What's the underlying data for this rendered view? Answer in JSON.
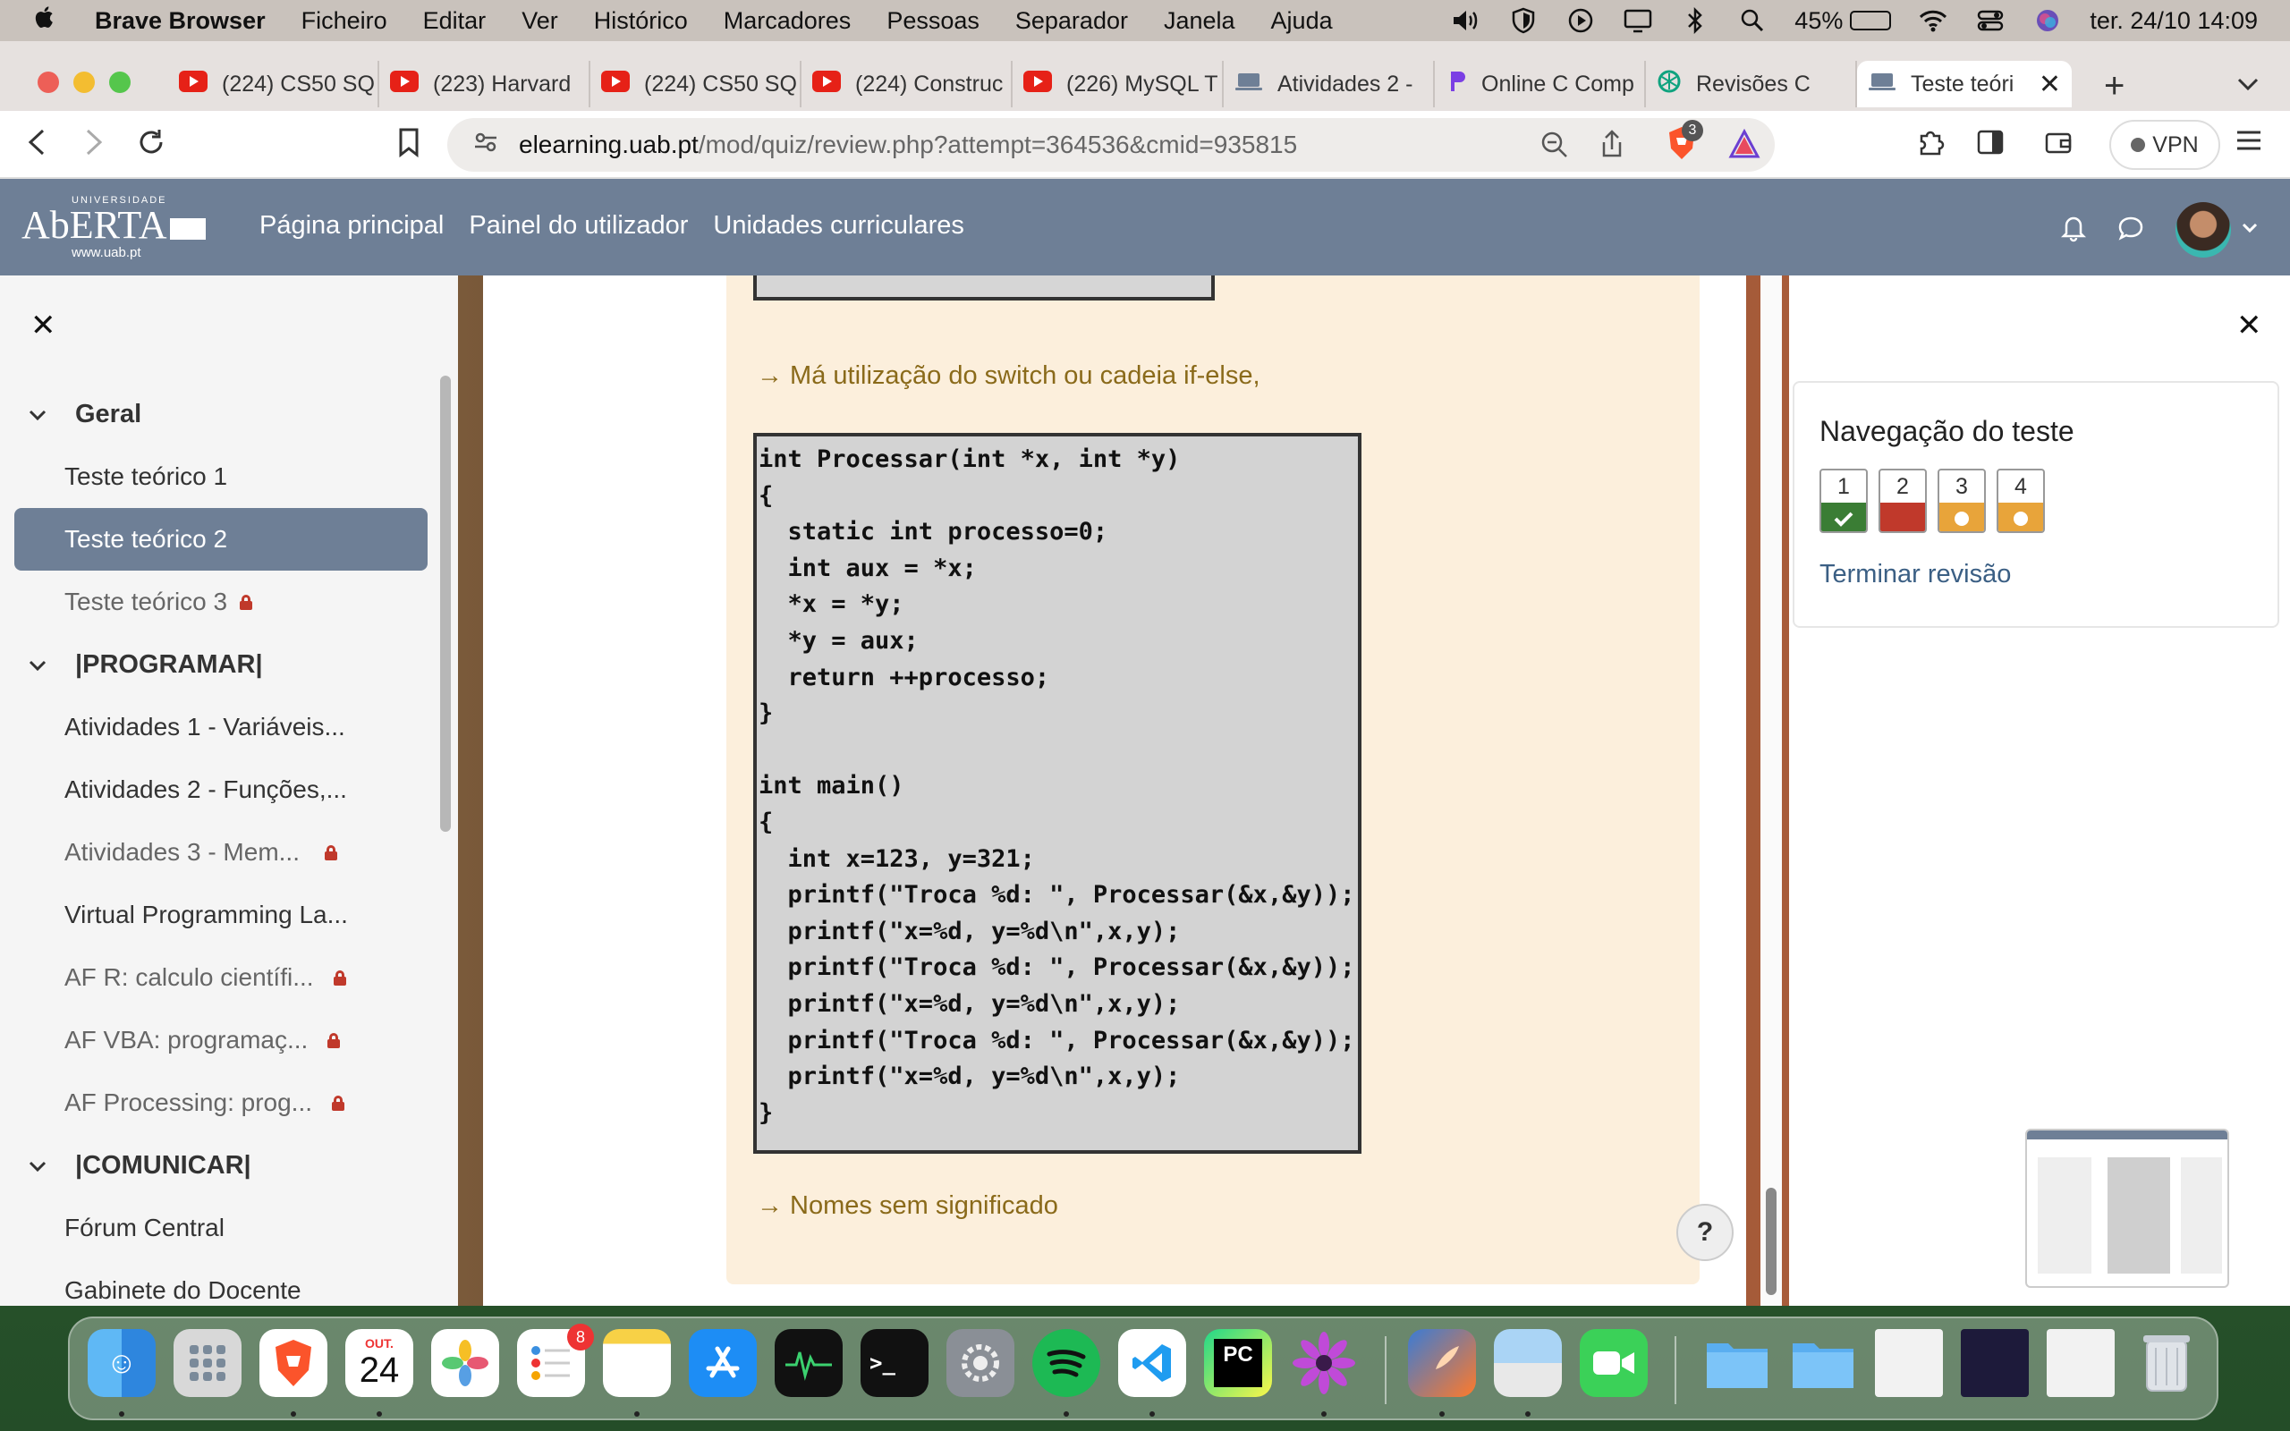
{
  "menubar": {
    "app": "Brave Browser",
    "items": [
      "Ficheiro",
      "Editar",
      "Ver",
      "Histórico",
      "Marcadores",
      "Pessoas",
      "Separador",
      "Janela",
      "Ajuda"
    ],
    "battery": "45%",
    "datetime": "ter. 24/10  14:09"
  },
  "tabs": [
    {
      "label": "(224) CS50 SQ",
      "icon": "youtube-icon"
    },
    {
      "label": "(223) Harvard",
      "icon": "youtube-icon"
    },
    {
      "label": "(224) CS50 SQ",
      "icon": "youtube-icon"
    },
    {
      "label": "(224) Construc",
      "icon": "youtube-icon"
    },
    {
      "label": "(226) MySQL T",
      "icon": "youtube-icon"
    },
    {
      "label": "Atividades 2 -",
      "icon": "laptop-icon"
    },
    {
      "label": "Online C Comp",
      "icon": "code-icon"
    },
    {
      "label": "Revisões C",
      "icon": "chatgpt-icon"
    },
    {
      "label": "Teste teóri",
      "icon": "laptop-icon",
      "active": true
    }
  ],
  "toolbar": {
    "url_host": "elearning.uab.pt",
    "url_path": "/mod/quiz/review.php?attempt=364536&cmid=935815",
    "brave_badge": "3",
    "vpn_label": "VPN"
  },
  "site": {
    "logo_top": "UNIVERSIDADE",
    "logo_name": "AbERTA",
    "logo_www": "www.uab.pt",
    "nav": [
      "Página principal",
      "Painel do utilizador",
      "Unidades curriculares"
    ]
  },
  "drawer": {
    "sections": [
      {
        "title": "Geral",
        "items": [
          {
            "label": "Teste teórico 1"
          },
          {
            "label": "Teste teórico 2",
            "active": true
          },
          {
            "label": "Teste teórico 3",
            "locked": true,
            "muted": true
          }
        ]
      },
      {
        "title": "|PROGRAMAR|",
        "items": [
          {
            "label": "Atividades 1 - Variáveis..."
          },
          {
            "label": "Atividades 2 - Funções,..."
          },
          {
            "label": "Atividades 3 - Mem...",
            "locked": true,
            "muted": true
          },
          {
            "label": "Virtual Programming La..."
          },
          {
            "label": "AF R: calculo científi...",
            "locked": true,
            "muted": true
          },
          {
            "label": "AF VBA: programaç...",
            "locked": true,
            "muted": true
          },
          {
            "label": "AF Processing: prog...",
            "locked": true,
            "muted": true
          }
        ]
      },
      {
        "title": "|COMUNICAR|",
        "items": [
          {
            "label": "Fórum Central"
          },
          {
            "label": "Gabinete do Docente"
          }
        ]
      }
    ]
  },
  "question": {
    "note1": "→ Má utilização do switch ou cadeia if-else,",
    "code": "int Processar(int *x, int *y)\n{\n  static int processo=0;\n  int aux = *x;\n  *x = *y;\n  *y = aux;\n  return ++processo;\n}\n\nint main()\n{\n  int x=123, y=321;\n  printf(\"Troca %d: \", Processar(&x,&y));\n  printf(\"x=%d, y=%d\\n\",x,y);\n  printf(\"Troca %d: \", Processar(&x,&y));\n  printf(\"x=%d, y=%d\\n\",x,y);\n  printf(\"Troca %d: \", Processar(&x,&y));\n  printf(\"x=%d, y=%d\\n\",x,y);\n}",
    "note2": "→ Nomes sem significado"
  },
  "quiznav": {
    "title": "Navegação do teste",
    "questions": [
      {
        "num": "1",
        "state": "correct",
        "color": "#3a7d34"
      },
      {
        "num": "2",
        "state": "incorrect",
        "color": "#c0392b"
      },
      {
        "num": "3",
        "state": "partial",
        "color": "#e8a43a"
      },
      {
        "num": "4",
        "state": "partial",
        "color": "#e8a43a"
      }
    ],
    "finish": "Terminar revisão"
  },
  "help": "?",
  "dock": {
    "calendar_month": "OUT.",
    "calendar_day": "24",
    "reminders_badge": "8"
  }
}
